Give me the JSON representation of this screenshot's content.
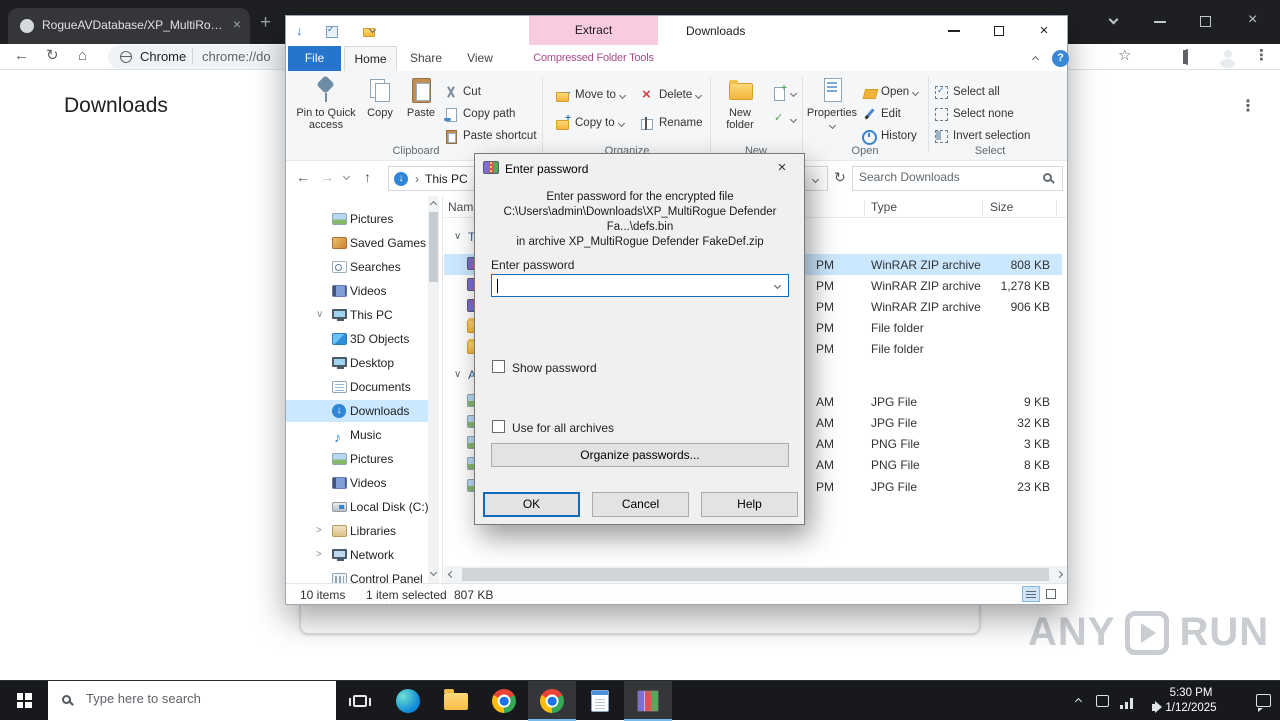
{
  "icons": {
    "close": "×",
    "plus": "+",
    "kebab": "⋮",
    "back": "←",
    "forward": "→",
    "refresh": "↻",
    "home": "⌂",
    "star": "☆",
    "down_arrow": "↓",
    "up_arrow": "↑",
    "chevron": "›",
    "expanded": "∨",
    "collapsed": ">",
    "help": "?"
  },
  "browser": {
    "tab_title": "RogueAVDatabase/XP_MultiRog...",
    "omnibox_site": "Chrome",
    "omnibox_url": "chrome://do",
    "page_title": "Downloads"
  },
  "explorer": {
    "window_title": "Downloads",
    "context_group": "Extract",
    "context_tools": "Compressed Folder Tools",
    "tabs": {
      "file": "File",
      "home": "Home",
      "share": "Share",
      "view": "View"
    },
    "ribbon": {
      "clipboard": {
        "pin": "Pin to Quick access",
        "copy": "Copy",
        "paste": "Paste",
        "cut": "Cut",
        "copy_path": "Copy path",
        "paste_shortcut": "Paste shortcut",
        "label": "Clipboard"
      },
      "organize": {
        "move_to": "Move to",
        "copy_to": "Copy to",
        "delete": "Delete",
        "rename": "Rename",
        "label": "Organize"
      },
      "new_group": {
        "new_folder": "New folder",
        "label": "New"
      },
      "open_group": {
        "properties": "Properties",
        "open": "Open",
        "edit": "Edit",
        "history": "History",
        "label": "Open"
      },
      "select_group": {
        "select_all": "Select all",
        "select_none": "Select none",
        "invert": "Invert selection",
        "label": "Select"
      }
    },
    "address": {
      "root": "This PC",
      "search_placeholder": "Search Downloads"
    },
    "columns": {
      "name": "Name",
      "type": "Type",
      "size": "Size"
    },
    "groups": [
      {
        "label": "To"
      },
      {
        "label": "A"
      }
    ],
    "files": [
      {
        "icon": "winrar-archive",
        "type": "WinRAR ZIP archive",
        "size": "808 KB",
        "date_end": "PM",
        "selected": true
      },
      {
        "icon": "winrar-archive",
        "type": "WinRAR ZIP archive",
        "size": "1,278 KB",
        "date_end": "PM",
        "selected": false
      },
      {
        "icon": "winrar-archive",
        "type": "WinRAR ZIP archive",
        "size": "906 KB",
        "date_end": "PM",
        "selected": false
      },
      {
        "icon": "folder",
        "type": "File folder",
        "size": "",
        "date_end": "PM",
        "selected": false
      },
      {
        "icon": "folder",
        "type": "File folder",
        "size": "",
        "date_end": "PM",
        "selected": false
      },
      {
        "icon": "image",
        "type": "JPG File",
        "size": "9 KB",
        "date_end": "AM",
        "selected": false
      },
      {
        "icon": "image",
        "type": "JPG File",
        "size": "32 KB",
        "date_end": "AM",
        "selected": false
      },
      {
        "icon": "image",
        "type": "PNG File",
        "size": "3 KB",
        "date_end": "AM",
        "selected": false
      },
      {
        "icon": "image",
        "type": "PNG File",
        "size": "8 KB",
        "date_end": "AM",
        "selected": false
      },
      {
        "icon": "image",
        "type": "JPG File",
        "size": "23 KB",
        "date_end": "PM",
        "selected": false
      }
    ],
    "nav": [
      {
        "label": "Pictures"
      },
      {
        "label": "Saved Games"
      },
      {
        "label": "Searches"
      },
      {
        "label": "Videos"
      },
      {
        "label": "This PC",
        "expander": "∨"
      },
      {
        "label": "3D Objects"
      },
      {
        "label": "Desktop"
      },
      {
        "label": "Documents"
      },
      {
        "label": "Downloads",
        "selected": true
      },
      {
        "label": "Music"
      },
      {
        "label": "Pictures"
      },
      {
        "label": "Videos"
      },
      {
        "label": "Local Disk (C:)"
      },
      {
        "label": "Libraries",
        "expander": ">"
      },
      {
        "label": "Network",
        "expander": ">"
      },
      {
        "label": "Control Panel"
      }
    ],
    "status": {
      "items": "10 items",
      "selected": "1 item selected",
      "size": "807 KB"
    }
  },
  "dialog": {
    "title": "Enter password",
    "line1": "Enter password for the encrypted file",
    "line2": "C:\\Users\\admin\\Downloads\\XP_MultiRogue Defender Fa...\\defs.bin",
    "line3": "in archive XP_MultiRogue Defender FakeDef.zip",
    "password_label": "Enter password",
    "show_password": "Show password",
    "use_for_all": "Use for all archives",
    "organize_passwords": "Organize passwords...",
    "ok": "OK",
    "cancel": "Cancel",
    "help": "Help"
  },
  "taskbar": {
    "search_placeholder": "Type here to search",
    "time": "5:30 PM",
    "date": "1/12/2025"
  },
  "watermark": {
    "left": "ANY",
    "right": "RUN"
  }
}
